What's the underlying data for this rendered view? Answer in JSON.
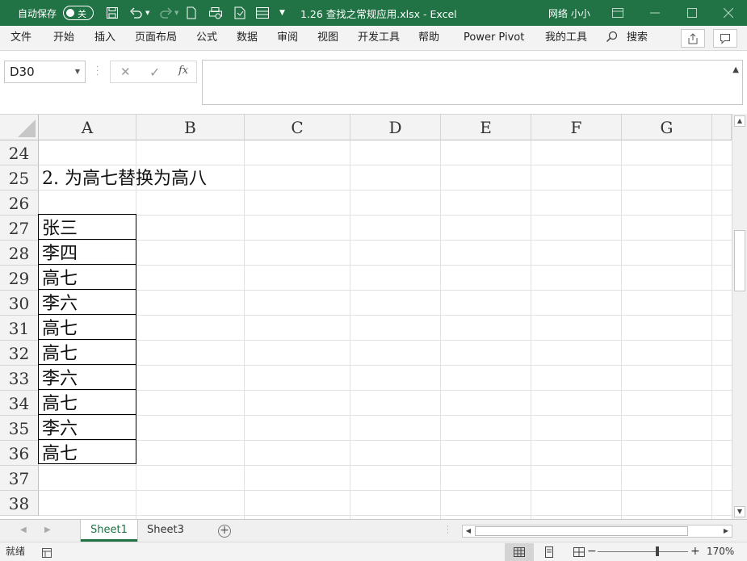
{
  "titlebar": {
    "autosave_label": "自动保存",
    "autosave_state": "关",
    "doc_title": "1.26 查找之常规应用.xlsx  -  Excel",
    "user": "网络 小小",
    "quick_access_icons": [
      "save-icon",
      "undo-icon",
      "redo-icon",
      "new-file-icon",
      "print-preview-icon",
      "form-icon",
      "customize-icon"
    ],
    "window_buttons": [
      "ribbon-display-icon",
      "minimize-icon",
      "maximize-icon",
      "close-icon"
    ]
  },
  "ribbon": {
    "tabs": [
      "文件",
      "开始",
      "插入",
      "页面布局",
      "公式",
      "数据",
      "审阅",
      "视图",
      "开发工具",
      "帮助",
      "Power Pivot",
      "我的工具"
    ],
    "search_label": "搜索",
    "share_icon": "share-icon",
    "comment_icon": "comment-icon"
  },
  "formula_bar": {
    "name_box": "D30",
    "cancel_glyph": "✕",
    "enter_glyph": "✓",
    "fx_label": "fx",
    "formula_value": ""
  },
  "sheet": {
    "columns": [
      "A",
      "B",
      "C",
      "D",
      "E",
      "F",
      "G"
    ],
    "rows": [
      "24",
      "25",
      "26",
      "27",
      "28",
      "29",
      "30",
      "31",
      "32",
      "33",
      "34",
      "35",
      "36",
      "37",
      "38"
    ],
    "cells": {
      "A25": "2. 为高七替换为高八",
      "A27": "张三",
      "A28": "李四",
      "A29": "高七",
      "A30": "李六",
      "A31": "高七",
      "A32": "高七",
      "A33": "李六",
      "A34": "高七",
      "A35": "李六",
      "A36": "高七"
    },
    "active_cell": "D30"
  },
  "sheet_tabs": {
    "tabs": [
      "Sheet1",
      "Sheet3"
    ],
    "active": "Sheet1",
    "add_glyph": "+"
  },
  "statusbar": {
    "status": "就绪",
    "zoom": "170%",
    "zoom_minus": "−",
    "zoom_plus": "+"
  },
  "colors": {
    "accent": "#217346",
    "header_bg": "#f3f3f3",
    "gridline": "#e1e1e1"
  }
}
